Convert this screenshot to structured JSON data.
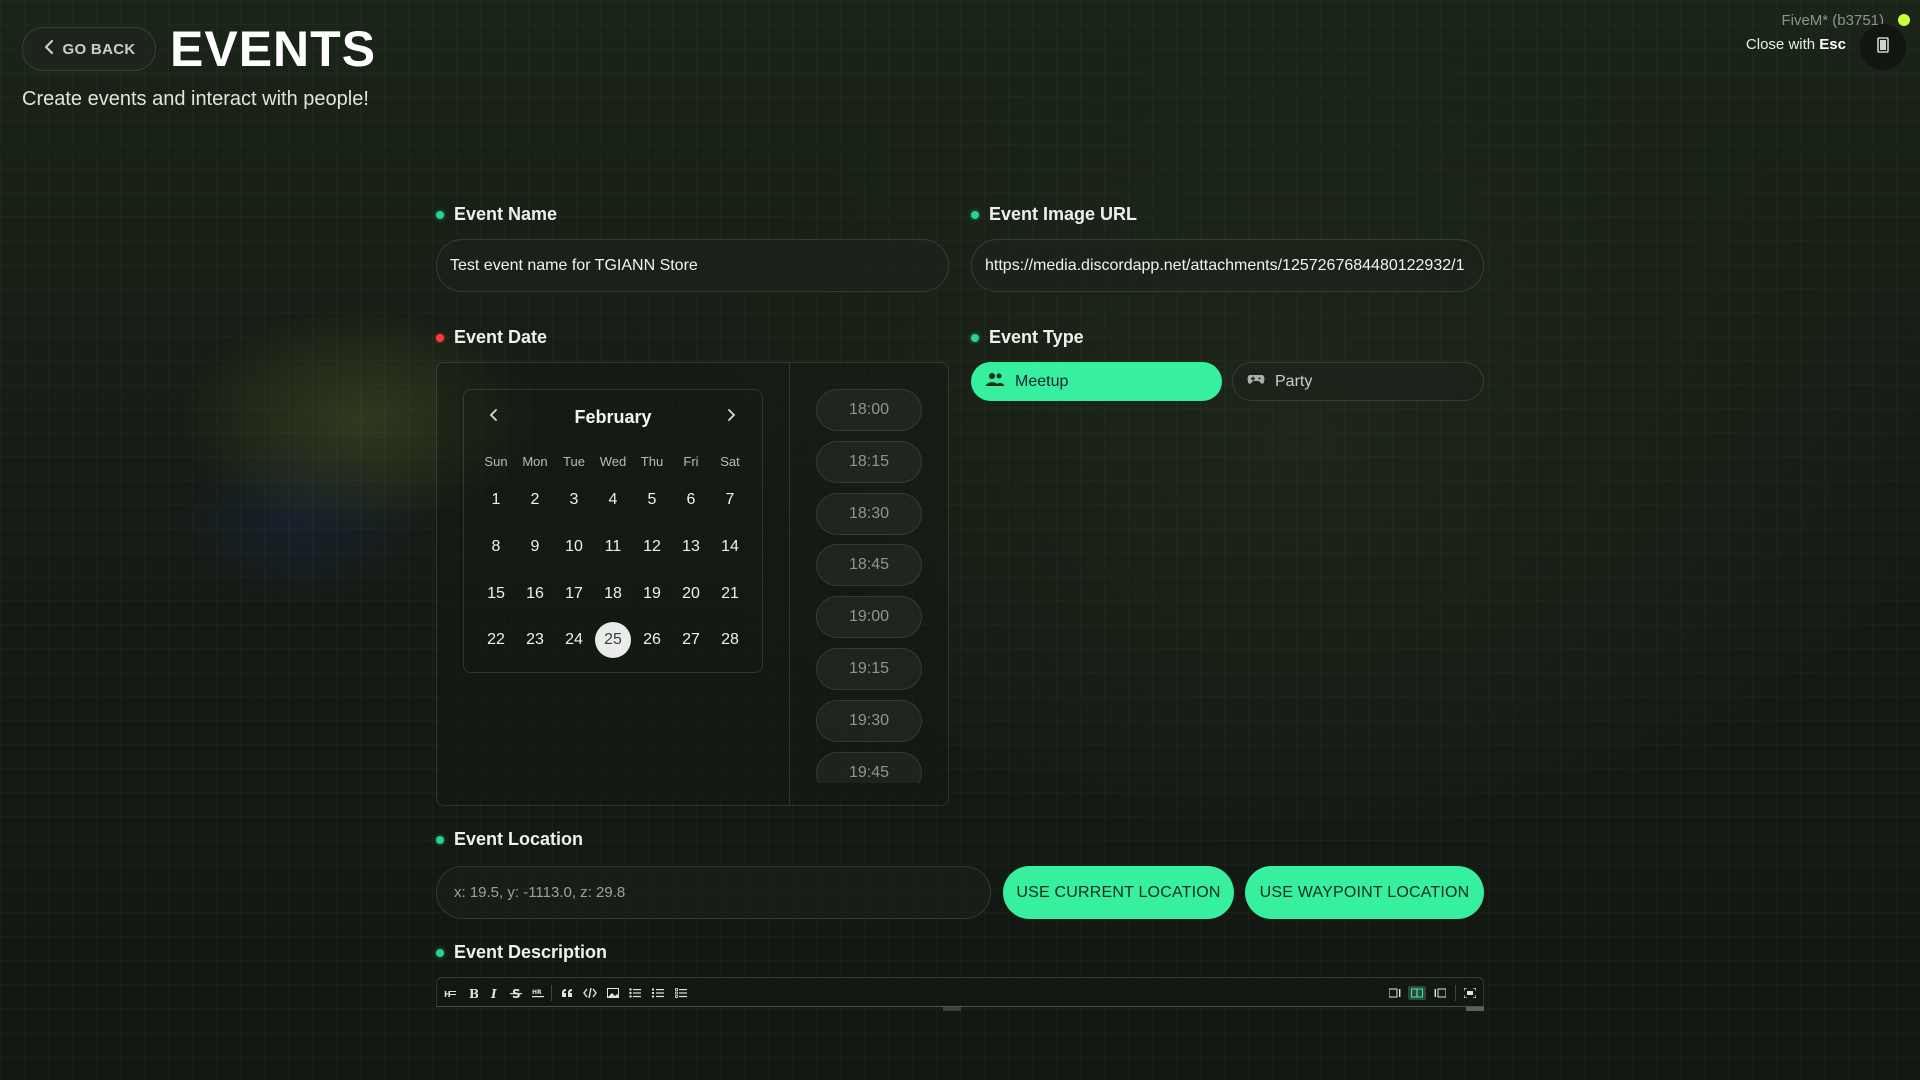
{
  "header": {
    "back_label": "GO BACK",
    "title": "EVENTS",
    "subtitle": "Create events and interact with people!",
    "client_info": "FiveM* (b3751)",
    "close_prefix": "Close with",
    "close_key": "Esc"
  },
  "event_name": {
    "label": "Event Name",
    "value": "Test event name for TGIANN Store"
  },
  "event_image": {
    "label": "Event Image URL",
    "value": "https://media.discordapp.net/attachments/1257267684480122932/1"
  },
  "event_date": {
    "label": "Event Date",
    "month": "February",
    "weekdays": [
      "Sun",
      "Mon",
      "Tue",
      "Wed",
      "Thu",
      "Fri",
      "Sat"
    ],
    "weeks": [
      [
        "1",
        "2",
        "3",
        "4",
        "5",
        "6",
        "7"
      ],
      [
        "8",
        "9",
        "10",
        "11",
        "12",
        "13",
        "14"
      ],
      [
        "15",
        "16",
        "17",
        "18",
        "19",
        "20",
        "21"
      ],
      [
        "22",
        "23",
        "24",
        "25",
        "26",
        "27",
        "28"
      ]
    ],
    "selected_day": "25",
    "times": [
      "18:00",
      "18:15",
      "18:30",
      "18:45",
      "19:00",
      "19:15",
      "19:30",
      "19:45"
    ]
  },
  "event_type": {
    "label": "Event Type",
    "options": [
      {
        "label": "Meetup",
        "icon": "users-icon",
        "selected": true
      },
      {
        "label": "Party",
        "icon": "gamepad-icon",
        "selected": false
      }
    ]
  },
  "event_location": {
    "label": "Event Location",
    "value": "x: 19.5, y: -1113.0, z: 29.8",
    "use_current": "USE CURRENT LOCATION",
    "use_waypoint": "USE WAYPOINT LOCATION"
  },
  "event_description": {
    "label": "Event Description",
    "toolbar": [
      "heading-icon",
      "bold-icon",
      "italic-icon",
      "strikethrough-icon",
      "horizontal-rule-icon",
      "quote-icon",
      "code-icon",
      "image-icon",
      "bullet-list-icon",
      "ordered-list-icon",
      "task-list-icon",
      "edit-mode-icon",
      "live-mode-icon",
      "preview-mode-icon",
      "fullscreen-icon"
    ]
  },
  "colors": {
    "accent": "#36f0a0",
    "required_dot": "#2bd28a",
    "error_dot": "#ff3b3b",
    "selected_day_bg": "#e9ece9"
  }
}
